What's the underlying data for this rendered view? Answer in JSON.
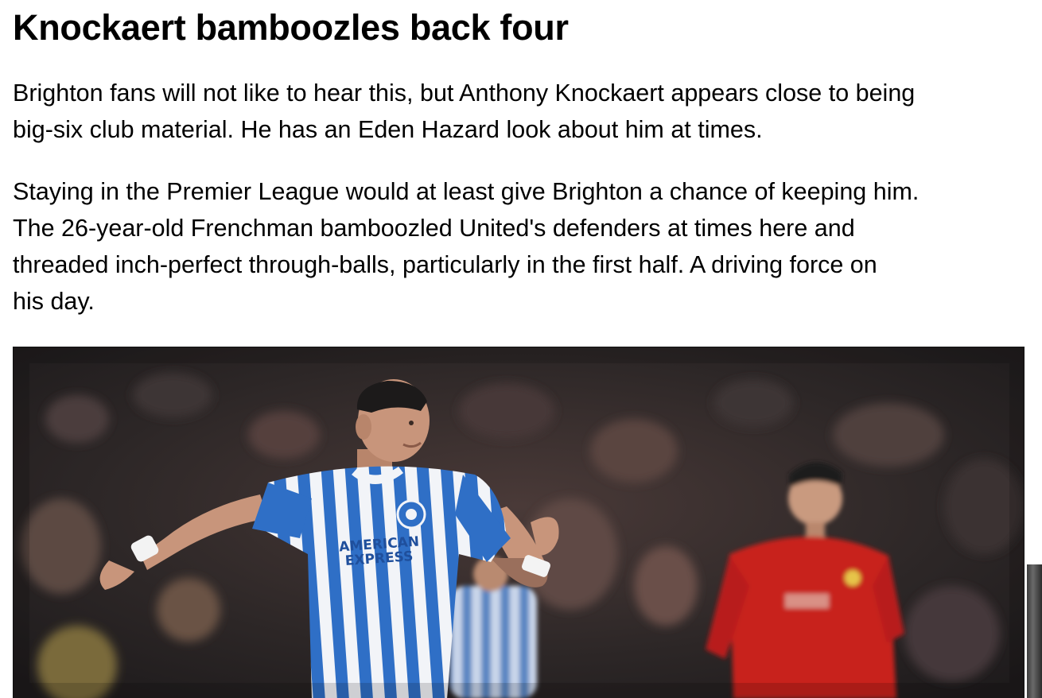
{
  "article": {
    "headline": "Knockaert bamboozles back four",
    "paragraph_1": [
      "Brighton fans will not like to hear this, but Anthony Knockaert appears close to being",
      "big-six club material. He has an Eden Hazard look about him at times."
    ],
    "paragraph_2": [
      "Staying in the Premier League would at least give Brighton a chance of keeping him.",
      "The 26-year-old Frenchman bamboozled United's defenders at times here and",
      "threaded inch-perfect through-balls, particularly in the first half. A driving force on",
      "his day."
    ]
  },
  "photo": {
    "shirt_sponsor": [
      "AMERICAN",
      "EXPRESS"
    ],
    "colors": {
      "brighton_blue": "#2f6fc6",
      "brighton_white": "#f2f4f8",
      "united_red": "#c8201e",
      "crowd_dark": "#2a2526"
    }
  }
}
